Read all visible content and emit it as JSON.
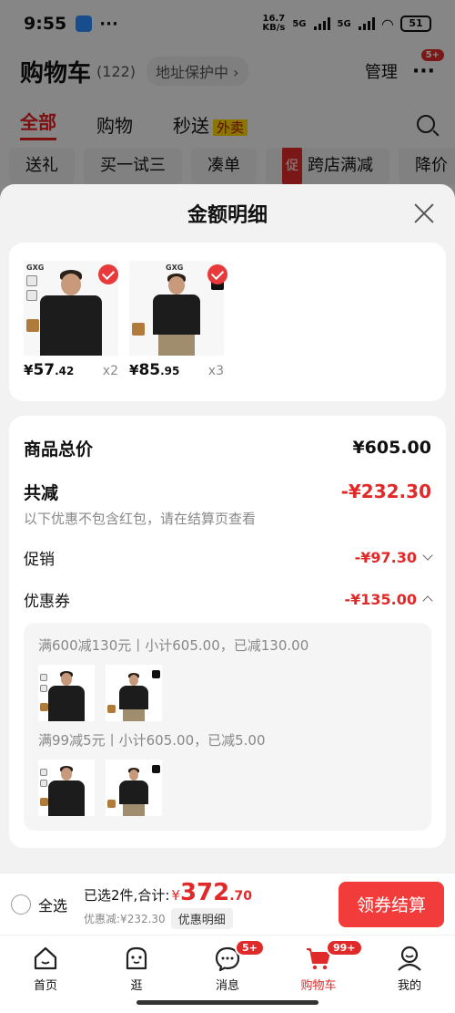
{
  "status": {
    "time": "9:55",
    "dots": "···",
    "net_speed": "16.7\nKB/s",
    "net1": "5G",
    "net2": "5G",
    "battery": "51"
  },
  "background_page": {
    "title": "购物车",
    "count": "(122)",
    "address": "地址保护中 ›",
    "manage": "管理",
    "more": "···",
    "more_badge": "5+",
    "tabs": [
      "全部",
      "购物",
      "秒送"
    ],
    "tab_tag": "外卖",
    "chips": [
      "送礼",
      "买一试三",
      "凑单",
      "跨店满减",
      "降价"
    ],
    "promo_icon_text": "促"
  },
  "sheet": {
    "title": "金额明细",
    "products": [
      {
        "brand": "GXG",
        "price_symbol": "¥",
        "price_int": "57",
        "price_dec": ".42",
        "qty": "x2"
      },
      {
        "brand": "GXG",
        "price_symbol": "¥",
        "price_int": "85",
        "price_dec": ".95",
        "qty": "x3"
      }
    ],
    "total_label": "商品总价",
    "total_value": "¥605.00",
    "reduce_label": "共减",
    "reduce_value": "-¥232.30",
    "note": "以下优惠不包含红包，请在结算页查看",
    "promo_label": "促销",
    "promo_value": "-¥97.30",
    "coupon_label": "优惠券",
    "coupon_value": "-¥135.00",
    "coupons": [
      {
        "text": "满600减130元丨小计605.00，已减130.00"
      },
      {
        "text": "满99减5元丨小计605.00，已减5.00"
      }
    ]
  },
  "checkout": {
    "select_all": "全选",
    "selected_text": "已选2件,合计:",
    "currency": "¥",
    "total_int": "372",
    "total_dec": ".70",
    "discount_text": "优惠减:¥232.30",
    "detail_btn": "优惠明细",
    "pay_btn": "领券结算"
  },
  "tabbar": [
    {
      "label": "首页",
      "icon": "home-icon"
    },
    {
      "label": "逛",
      "icon": "browse-icon"
    },
    {
      "label": "消息",
      "icon": "message-icon",
      "badge": "5+"
    },
    {
      "label": "购物车",
      "icon": "cart-icon",
      "badge": "99+"
    },
    {
      "label": "我的",
      "icon": "profile-icon"
    }
  ],
  "colors": {
    "accent": "#e02a2a",
    "pay_button": "#f23b3b"
  }
}
